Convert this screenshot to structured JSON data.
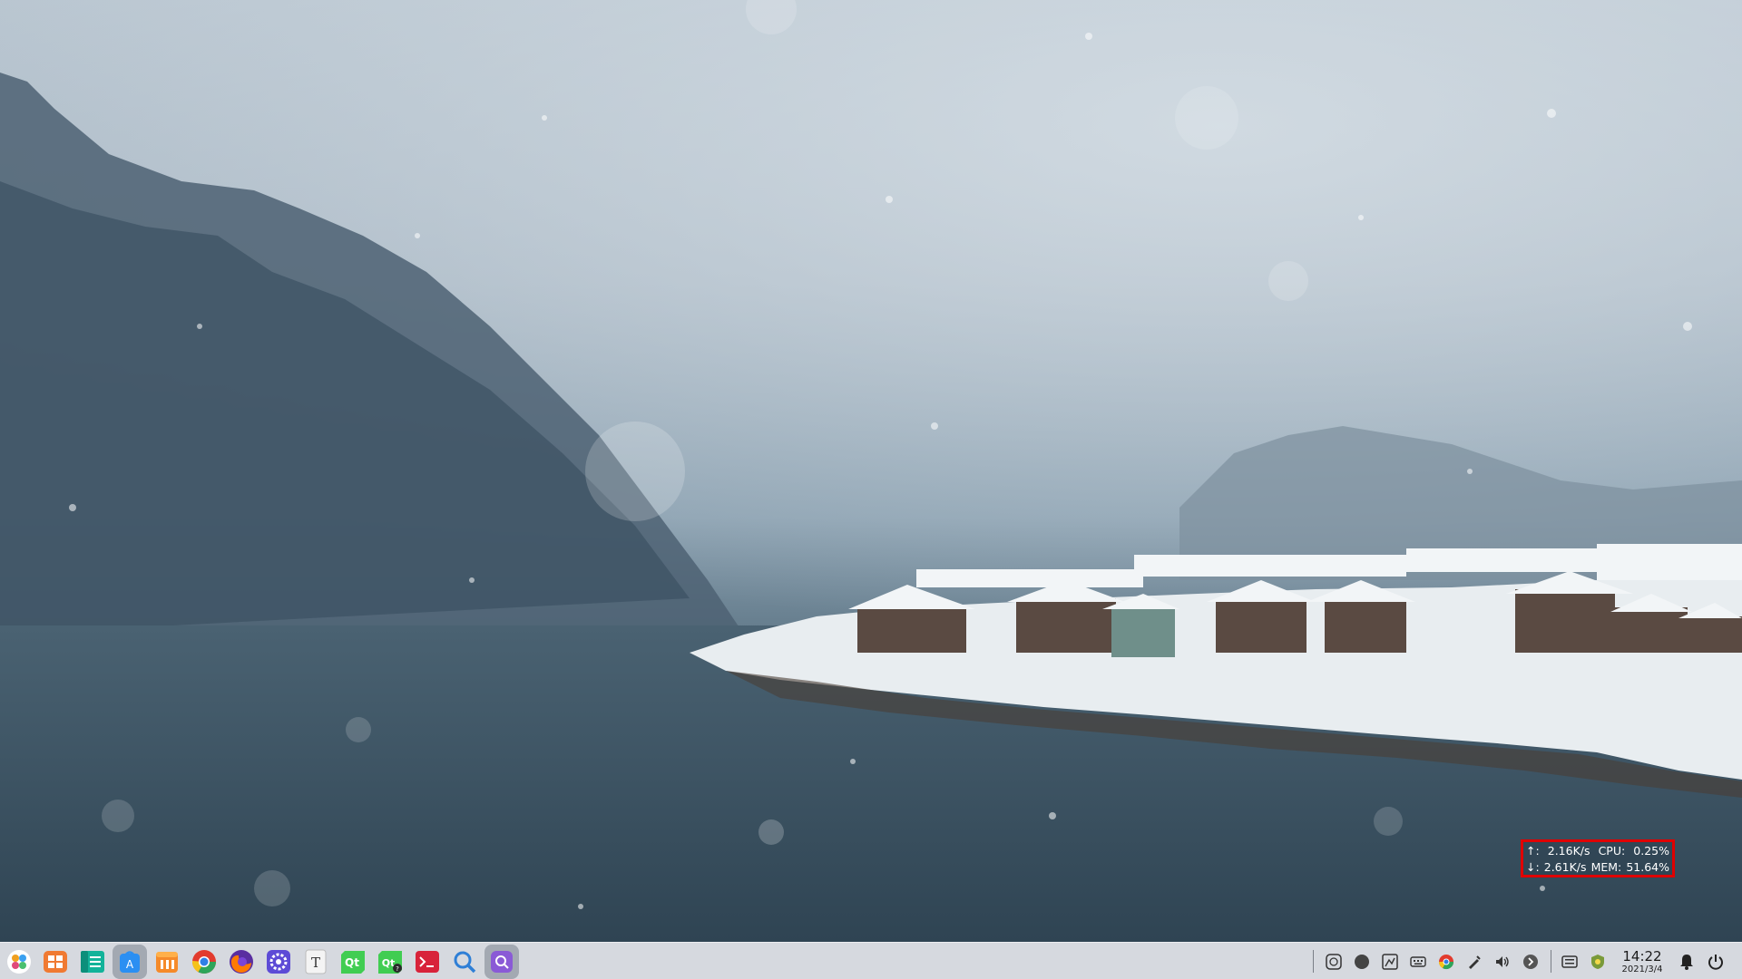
{
  "monitor": {
    "upload_label": "↑:",
    "upload_value": "2.16K/s",
    "cpu_label": "CPU:",
    "cpu_value": "0.25%",
    "download_label": "↓:",
    "download_value": "2.61K/s",
    "mem_label": "MEM:",
    "mem_value": "51.64%"
  },
  "taskbar": {
    "launcher_icon": "launcher-icon",
    "apps": [
      {
        "name": "multitasking-view-icon",
        "color": "#f07a32"
      },
      {
        "name": "file-manager-icon",
        "color": "#12b39a"
      },
      {
        "name": "app-store-icon",
        "color": "#2b8ff2",
        "active": true
      },
      {
        "name": "deepin-store-icon",
        "color": "#f58a2a"
      },
      {
        "name": "chrome-icon",
        "color": "#e23b2e"
      },
      {
        "name": "firefox-icon",
        "color": "#ff7a00"
      },
      {
        "name": "settings-icon",
        "color": "#5d4bd6"
      },
      {
        "name": "text-editor-icon",
        "color": "#f4f4f4"
      },
      {
        "name": "qt-creator-icon",
        "color": "#41cd52"
      },
      {
        "name": "qt-assistant-icon",
        "color": "#41cd52"
      },
      {
        "name": "terminal-icon",
        "color": "#d8233a"
      },
      {
        "name": "search-app-icon",
        "color": "#2f7fd6"
      },
      {
        "name": "screenshot-app-icon",
        "color": "#8a5ad6"
      }
    ],
    "tray": [
      "chat-tray-icon",
      "circle-tray-icon",
      "image-tray-icon",
      "keyboard-tray-icon",
      "chrome-tray-icon",
      "pen-tray-icon",
      "volume-tray-icon",
      "expand-tray-icon",
      "input-method-tray-icon",
      "shield-tray-icon"
    ],
    "clock": {
      "time": "14:22",
      "date": "2021/3/4"
    },
    "notification_icon": "bell-icon",
    "power_icon": "power-icon"
  }
}
